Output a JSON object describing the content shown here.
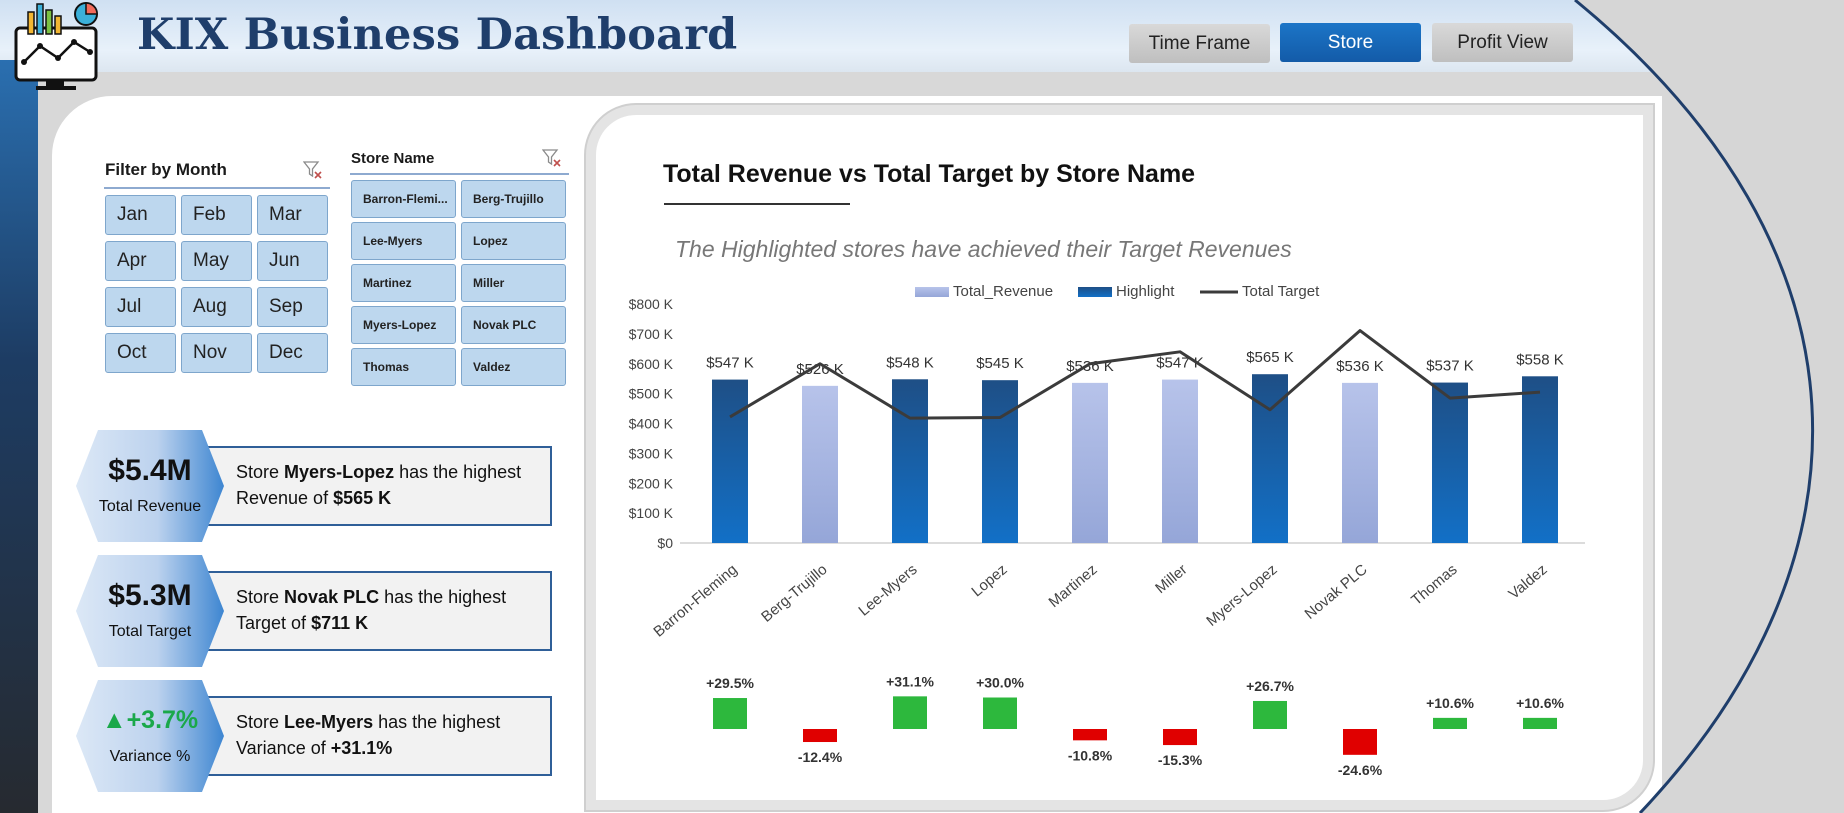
{
  "header": {
    "title": "KIX Business Dashboard",
    "tabs": [
      {
        "label": "Time Frame",
        "active": false
      },
      {
        "label": "Store",
        "active": true
      },
      {
        "label": "Profit View",
        "active": false
      }
    ]
  },
  "filters": {
    "month_title": "Filter by Month",
    "months": [
      "Jan",
      "Feb",
      "Mar",
      "Apr",
      "May",
      "Jun",
      "Jul",
      "Aug",
      "Sep",
      "Oct",
      "Nov",
      "Dec"
    ],
    "store_title": "Store Name",
    "stores": [
      "Barron-Flemi...",
      "Berg-Trujillo",
      "Lee-Myers",
      "Lopez",
      "Martinez",
      "Miller",
      "Myers-Lopez",
      "Novak PLC",
      "Thomas",
      "Valdez"
    ]
  },
  "kpis": [
    {
      "value": "$5.4M",
      "label": "Total Revenue",
      "prefix": "Store",
      "store": "Myers-Lopez",
      "suffix": "has the highest",
      "line2": "Revenue of",
      "amount": "$565 K"
    },
    {
      "value": "$5.3M",
      "label": "Total Target",
      "prefix": "Store",
      "store": "Novak PLC",
      "suffix": "has the highest",
      "line2": "Target of",
      "amount": "$711 K"
    },
    {
      "value": "▲+3.7%",
      "label": "Variance %",
      "prefix": "Store",
      "store": "Lee-Myers",
      "suffix": "has the highest",
      "line2": "Variance of",
      "amount": "+31.1%"
    }
  ],
  "colors": {
    "revenue": "#aab7e0",
    "highlight": "#1565b5",
    "target_line": "#3b3b3b",
    "positive": "#2db83d",
    "negative": "#e00000",
    "kpi_positive_text": "#1aa84a"
  },
  "chart_data": {
    "type": "bar",
    "title": "Total Revenue vs Total Target by Store Name",
    "subtitle": "The Highlighted stores have achieved their Target Revenues",
    "categories": [
      "Barron-Fleming",
      "Berg-Trujillo",
      "Lee-Myers",
      "Lopez",
      "Martinez",
      "Miller",
      "Myers-Lopez",
      "Novak PLC",
      "Thomas",
      "Valdez"
    ],
    "series": [
      {
        "name": "Total_Revenue",
        "values": [
          547,
          526,
          548,
          545,
          536,
          547,
          565,
          536,
          537,
          558
        ]
      },
      {
        "name": "Highlight",
        "values": [
          547,
          null,
          548,
          545,
          null,
          null,
          565,
          null,
          537,
          558
        ]
      },
      {
        "name": "Total Target",
        "values": [
          422,
          600,
          418,
          420,
          600,
          640,
          446,
          711,
          485,
          505
        ]
      }
    ],
    "data_labels": [
      "$547 K",
      "$526 K",
      "$548 K",
      "$545 K",
      "$536 K",
      "$547 K",
      "$565 K",
      "$536 K",
      "$537 K",
      "$558 K"
    ],
    "variance": [
      29.5,
      -12.4,
      31.1,
      30.0,
      -10.8,
      -15.3,
      26.7,
      -24.6,
      10.6,
      10.6
    ],
    "variance_labels": [
      "+29.5%",
      "-12.4%",
      "+31.1%",
      "+30.0%",
      "-10.8%",
      "-15.3%",
      "+26.7%",
      "-24.6%",
      "+10.6%",
      "+10.6%"
    ],
    "y_ticks": [
      "$0",
      "$100 K",
      "$200 K",
      "$300 K",
      "$400 K",
      "$500 K",
      "$600 K",
      "$700 K",
      "$800 K"
    ],
    "ylim": [
      0,
      800
    ],
    "legend": "top"
  }
}
